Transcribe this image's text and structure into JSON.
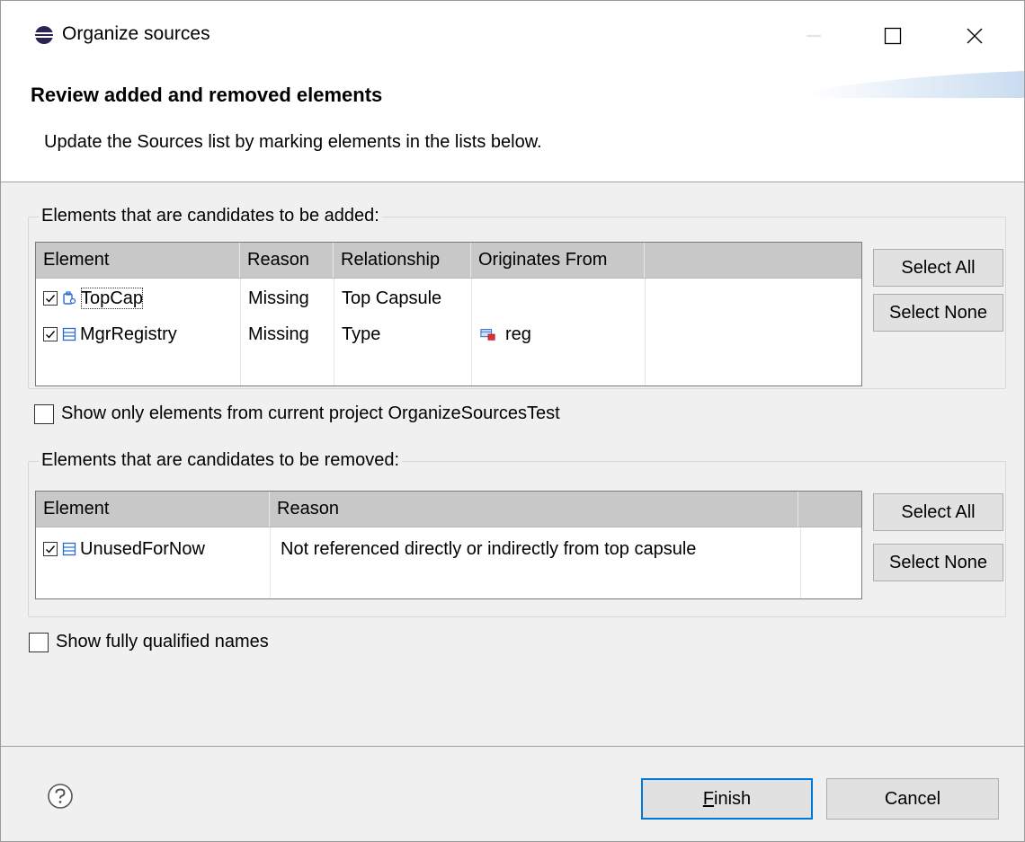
{
  "window": {
    "title": "Organize sources",
    "icon": "eclipse-icon",
    "controls": [
      "minimize-icon",
      "maximize-icon",
      "close-icon"
    ]
  },
  "banner": {
    "title": "Review added and removed elements",
    "description": "Update the Sources list by marking elements in the lists below."
  },
  "added_group": {
    "legend": "Elements that are candidates to be added:",
    "columns": [
      "Element",
      "Reason",
      "Relationship",
      "Originates From"
    ],
    "rows": [
      {
        "checked": true,
        "icon": "capsule-icon",
        "element": "TopCap",
        "reason": "Missing",
        "relationship": "Top Capsule",
        "originates": ""
      },
      {
        "checked": true,
        "icon": "class-icon",
        "element": "MgrRegistry",
        "reason": "Missing",
        "relationship": "Type",
        "originates_icon": "part-icon",
        "originates": "reg"
      }
    ],
    "select_all": "Select All",
    "select_none": "Select None"
  },
  "show_current_project": {
    "checked": false,
    "label": "Show only elements from current project OrganizeSourcesTest"
  },
  "removed_group": {
    "legend": "Elements that are candidates to be removed:",
    "columns": [
      "Element",
      "Reason"
    ],
    "rows": [
      {
        "checked": true,
        "icon": "class-icon",
        "element": "UnusedForNow",
        "reason": "Not referenced directly or indirectly from top capsule"
      }
    ],
    "select_all": "Select All",
    "select_none": "Select None"
  },
  "show_qualified": {
    "checked": false,
    "label": "Show fully qualified names"
  },
  "footer": {
    "help_icon": "help-icon",
    "finish_prefix": "",
    "finish_mnemonic": "F",
    "finish_rest": "inish",
    "cancel": "Cancel"
  },
  "colors": {
    "accent": "#0078d7",
    "header_bg": "#c8c8c8",
    "dialog_bg": "#f0f0f0"
  }
}
